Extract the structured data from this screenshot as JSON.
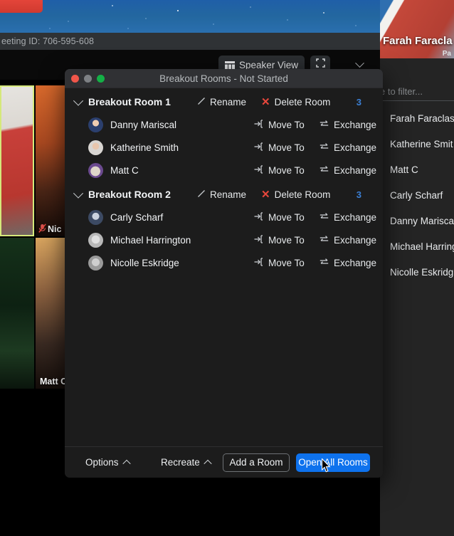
{
  "meeting": {
    "meeting_id_label": "eeting ID: 706-595-608",
    "speaker_view_label": "Speaker View",
    "speaker_view_icon": "grid-icon",
    "fullscreen_icon": "fullscreen-icon",
    "chevron_icon": "chevron-down-icon"
  },
  "filmstrip": [
    {
      "name": "",
      "muted": false,
      "active": true
    },
    {
      "name": "Nic",
      "muted": true,
      "active": false
    },
    {
      "name": "",
      "muted": false,
      "active": false
    },
    {
      "name": "Matt C",
      "muted": false,
      "active": false
    }
  ],
  "participants_panel": {
    "video_name": "Farah Faracla",
    "video_sub": "Pa",
    "filter_placeholder": "e to filter...",
    "names": [
      "Farah Faraclas",
      "Katherine Smit",
      "Matt C",
      "Carly Scharf",
      "Danny Marisca",
      "Michael Harring",
      "Nicolle Eskridg"
    ]
  },
  "dialog": {
    "title": "Breakout Rooms - Not Started",
    "window_controls": [
      "close",
      "minimize",
      "zoom"
    ],
    "accent_blue": "#0e72ed",
    "count_blue": "#3b7fd4",
    "delete_red": "#e8473c",
    "labels": {
      "rename": "Rename",
      "delete_room": "Delete Room",
      "move_to": "Move To",
      "exchange": "Exchange"
    },
    "rooms": [
      {
        "name": "Breakout Room 1",
        "count": "3",
        "participants": [
          {
            "name": "Danny Mariscal"
          },
          {
            "name": "Katherine Smith"
          },
          {
            "name": "Matt C"
          }
        ]
      },
      {
        "name": "Breakout Room 2",
        "count": "3",
        "participants": [
          {
            "name": "Carly Scharf"
          },
          {
            "name": "Michael Harrington"
          },
          {
            "name": "Nicolle Eskridge"
          }
        ]
      }
    ],
    "footer": {
      "options_label": "Options",
      "recreate_label": "Recreate",
      "add_room_label": "Add a Room",
      "open_all_label": "Open All Rooms"
    }
  }
}
